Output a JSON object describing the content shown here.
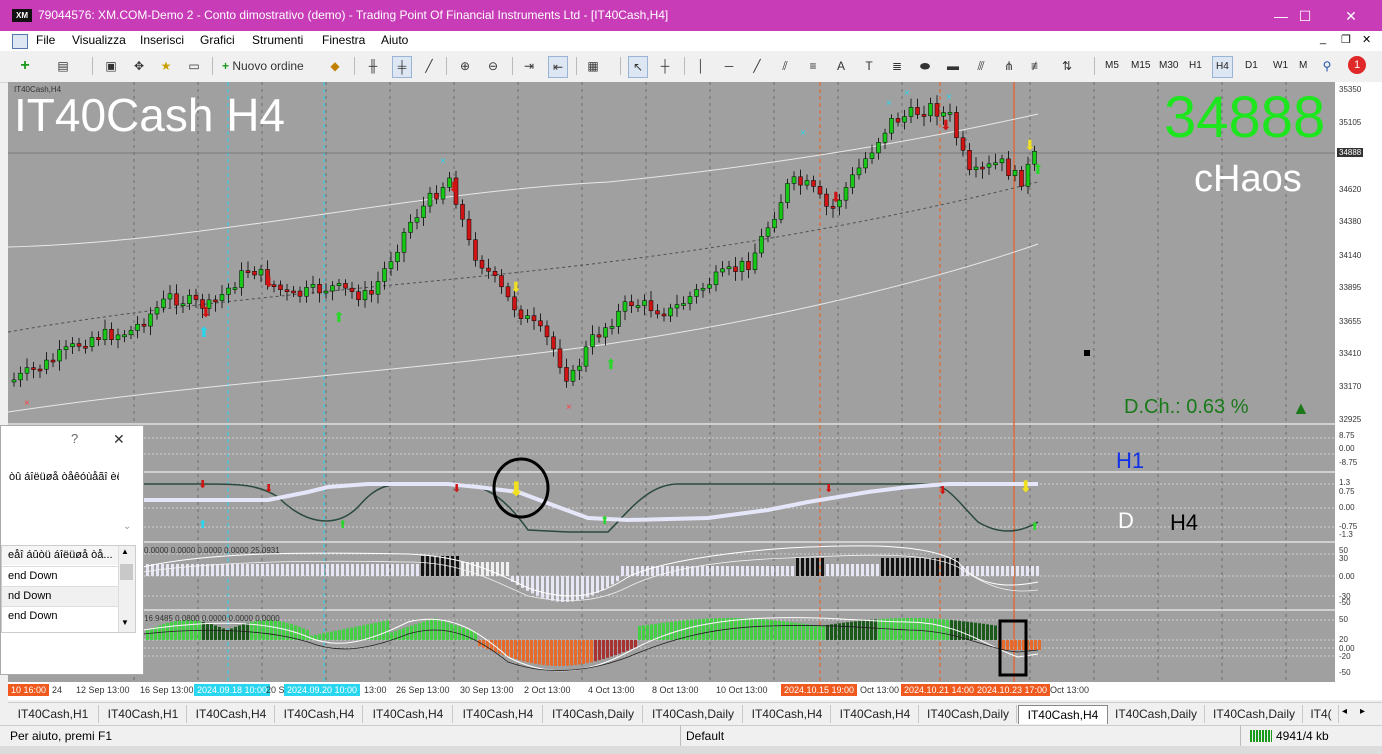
{
  "window": {
    "title": "79044576: XM.COM-Demo 2 - Conto dimostrativo (demo) - Trading Point Of Financial Instruments Ltd - [IT40Cash,H4]",
    "logo": "XM",
    "minimize": "—",
    "maximize": "☐",
    "close": "✕"
  },
  "menu": [
    "File",
    "Visualizza",
    "Inserisci",
    "Grafici",
    "Strumenti",
    "Finestra",
    "Aiuto"
  ],
  "toolbar": {
    "new_order": "Nuovo ordine",
    "timeframes": [
      "M5",
      "M15",
      "M30",
      "H1",
      "H4",
      "D1",
      "W1",
      "M"
    ],
    "active_timeframe": "H4",
    "alert_badge": "1"
  },
  "chart": {
    "symbol_small": "IT40Cash,H4",
    "big_title": "IT40Cash H4",
    "price_big": "34888",
    "chaos_label": "cHaos",
    "dch_label": "D.Ch.: 0.63 %",
    "h1_label": "H1",
    "d_label": "D",
    "h4_label": "H4",
    "osc1_values": "0.0000 0.0000 0.0000 0.0000 25.0931",
    "osc2_values": "16.9485 0.0800 0.0000 0.0000 0.0000",
    "colors": {
      "price_up": "#18c818",
      "price_down": "#d01414",
      "big_price": "#1ee61e",
      "dch": "#1a7a1a",
      "accent_red": "#f05a1e",
      "accent_cyan": "#29d6f0"
    }
  },
  "price_scale": {
    "labels": [
      "35350",
      "35105",
      "34888",
      "34620",
      "34380",
      "34140",
      "33895",
      "33655",
      "33410",
      "33170",
      "32925"
    ],
    "current": "34888",
    "h1_labels": [
      "8.75",
      "0.00",
      "-8.75"
    ],
    "d_labels": [
      "1.3",
      "0.75",
      "0.00",
      "-0.75",
      "-1.3"
    ],
    "osc1_labels": [
      "50",
      "30",
      "0.00",
      "-30",
      "-50"
    ],
    "osc2_labels": [
      "50",
      "20",
      "0.00",
      "-20",
      "-50"
    ]
  },
  "time_scale": {
    "labels": [
      "24",
      "12 Sep 13:00",
      "16 Sep 13:00",
      "20 Se",
      "13:00",
      "26 Sep 13:00",
      "30 Sep 13:00",
      "2 Oct 13:00",
      "4 Oct 13:00",
      "8 Oct 13:00",
      "10 Oct 13:00",
      "Oct 13:00",
      "Oct 13:00"
    ],
    "highlight_red": [
      "10 16:00",
      "2024.10.15 19:00",
      "2024.10.21 14:00",
      "2024.10.23 17:00"
    ],
    "highlight_cyan": [
      "2024.09.18 10:00",
      "2024.09.20 10:00"
    ]
  },
  "tabs": [
    "IT40Cash,H1",
    "IT40Cash,H1",
    "IT40Cash,H4",
    "IT40Cash,H4",
    "IT40Cash,H4",
    "IT40Cash,H4",
    "IT40Cash,Daily",
    "IT40Cash,Daily",
    "IT40Cash,H4",
    "IT40Cash,H4",
    "IT40Cash,Daily",
    "IT40Cash,H4",
    "IT40Cash,Daily",
    "IT40Cash,Daily",
    "IT4("
  ],
  "active_tab_index": 11,
  "status": {
    "help": "Per aiuto, premi F1",
    "profile": "Default",
    "traffic": "4941/4 kb"
  },
  "dialog": {
    "help": "?",
    "close": "✕",
    "text": "òû áîëüøå òåêóùåãî èë",
    "list_header": "eåî áûòü áîëüøå òå...",
    "rows": [
      "end Down",
      "nd Down",
      "end Down"
    ]
  }
}
